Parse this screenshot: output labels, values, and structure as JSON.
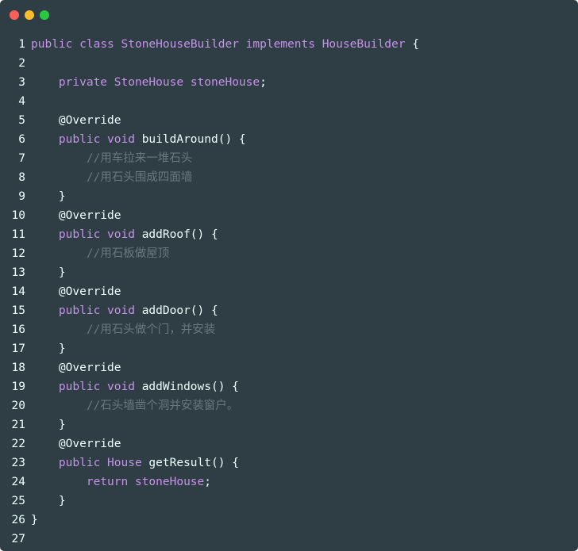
{
  "colors": {
    "background": "#2e3e44",
    "close": "#fd5f58",
    "minimize": "#febc2e",
    "maximize": "#28c840",
    "keyword": "#c792ea",
    "type": "#c792ea",
    "plain": "#eeffff",
    "annotation": "#eeffff",
    "comment": "#697880"
  },
  "window": {
    "buttons": [
      "close",
      "minimize",
      "maximize"
    ]
  },
  "code": {
    "lines": [
      {
        "n": "1",
        "tokens": [
          [
            "keyword",
            "public"
          ],
          [
            "plain",
            " "
          ],
          [
            "keyword",
            "class"
          ],
          [
            "plain",
            " "
          ],
          [
            "type",
            "StoneHouseBuilder"
          ],
          [
            "plain",
            " "
          ],
          [
            "keyword",
            "implements"
          ],
          [
            "plain",
            " "
          ],
          [
            "type",
            "HouseBuilder"
          ],
          [
            "plain",
            " {"
          ]
        ]
      },
      {
        "n": "2",
        "tokens": []
      },
      {
        "n": "3",
        "tokens": [
          [
            "plain",
            "    "
          ],
          [
            "keyword",
            "private"
          ],
          [
            "plain",
            " "
          ],
          [
            "type",
            "StoneHouse"
          ],
          [
            "plain",
            " "
          ],
          [
            "type",
            "stoneHouse"
          ],
          [
            "plain",
            ";"
          ]
        ]
      },
      {
        "n": "4",
        "tokens": []
      },
      {
        "n": "5",
        "tokens": [
          [
            "plain",
            "    "
          ],
          [
            "annotation",
            "@Override"
          ]
        ]
      },
      {
        "n": "6",
        "tokens": [
          [
            "plain",
            "    "
          ],
          [
            "keyword",
            "public"
          ],
          [
            "plain",
            " "
          ],
          [
            "keyword",
            "void"
          ],
          [
            "plain",
            " buildAround() {"
          ]
        ]
      },
      {
        "n": "7",
        "tokens": [
          [
            "plain",
            "        "
          ],
          [
            "comment",
            "//用车拉来一堆石头"
          ]
        ]
      },
      {
        "n": "8",
        "tokens": [
          [
            "plain",
            "        "
          ],
          [
            "comment",
            "//用石头围成四面墙"
          ]
        ]
      },
      {
        "n": "9",
        "tokens": [
          [
            "plain",
            "    }"
          ]
        ]
      },
      {
        "n": "10",
        "tokens": [
          [
            "plain",
            "    "
          ],
          [
            "annotation",
            "@Override"
          ]
        ]
      },
      {
        "n": "11",
        "tokens": [
          [
            "plain",
            "    "
          ],
          [
            "keyword",
            "public"
          ],
          [
            "plain",
            " "
          ],
          [
            "keyword",
            "void"
          ],
          [
            "plain",
            " addRoof() {"
          ]
        ]
      },
      {
        "n": "12",
        "tokens": [
          [
            "plain",
            "        "
          ],
          [
            "comment",
            "//用石板做屋顶"
          ]
        ]
      },
      {
        "n": "13",
        "tokens": [
          [
            "plain",
            "    }"
          ]
        ]
      },
      {
        "n": "14",
        "tokens": [
          [
            "plain",
            "    "
          ],
          [
            "annotation",
            "@Override"
          ]
        ]
      },
      {
        "n": "15",
        "tokens": [
          [
            "plain",
            "    "
          ],
          [
            "keyword",
            "public"
          ],
          [
            "plain",
            " "
          ],
          [
            "keyword",
            "void"
          ],
          [
            "plain",
            " addDoor() {"
          ]
        ]
      },
      {
        "n": "16",
        "tokens": [
          [
            "plain",
            "        "
          ],
          [
            "comment",
            "//用石头做个门，并安装"
          ]
        ]
      },
      {
        "n": "17",
        "tokens": [
          [
            "plain",
            "    }"
          ]
        ]
      },
      {
        "n": "18",
        "tokens": [
          [
            "plain",
            "    "
          ],
          [
            "annotation",
            "@Override"
          ]
        ]
      },
      {
        "n": "19",
        "tokens": [
          [
            "plain",
            "    "
          ],
          [
            "keyword",
            "public"
          ],
          [
            "plain",
            " "
          ],
          [
            "keyword",
            "void"
          ],
          [
            "plain",
            " addWindows() {"
          ]
        ]
      },
      {
        "n": "20",
        "tokens": [
          [
            "plain",
            "        "
          ],
          [
            "comment",
            "//石头墙凿个洞并安装窗户。"
          ]
        ]
      },
      {
        "n": "21",
        "tokens": [
          [
            "plain",
            "    }"
          ]
        ]
      },
      {
        "n": "22",
        "tokens": [
          [
            "plain",
            "    "
          ],
          [
            "annotation",
            "@Override"
          ]
        ]
      },
      {
        "n": "23",
        "tokens": [
          [
            "plain",
            "    "
          ],
          [
            "keyword",
            "public"
          ],
          [
            "plain",
            " "
          ],
          [
            "type",
            "House"
          ],
          [
            "plain",
            " getResult() {"
          ]
        ]
      },
      {
        "n": "24",
        "tokens": [
          [
            "plain",
            "        "
          ],
          [
            "keyword",
            "return"
          ],
          [
            "plain",
            " "
          ],
          [
            "type",
            "stoneHouse"
          ],
          [
            "plain",
            ";"
          ]
        ]
      },
      {
        "n": "25",
        "tokens": [
          [
            "plain",
            "    }"
          ]
        ]
      },
      {
        "n": "26",
        "tokens": [
          [
            "plain",
            "}"
          ]
        ]
      },
      {
        "n": "27",
        "tokens": []
      }
    ]
  }
}
